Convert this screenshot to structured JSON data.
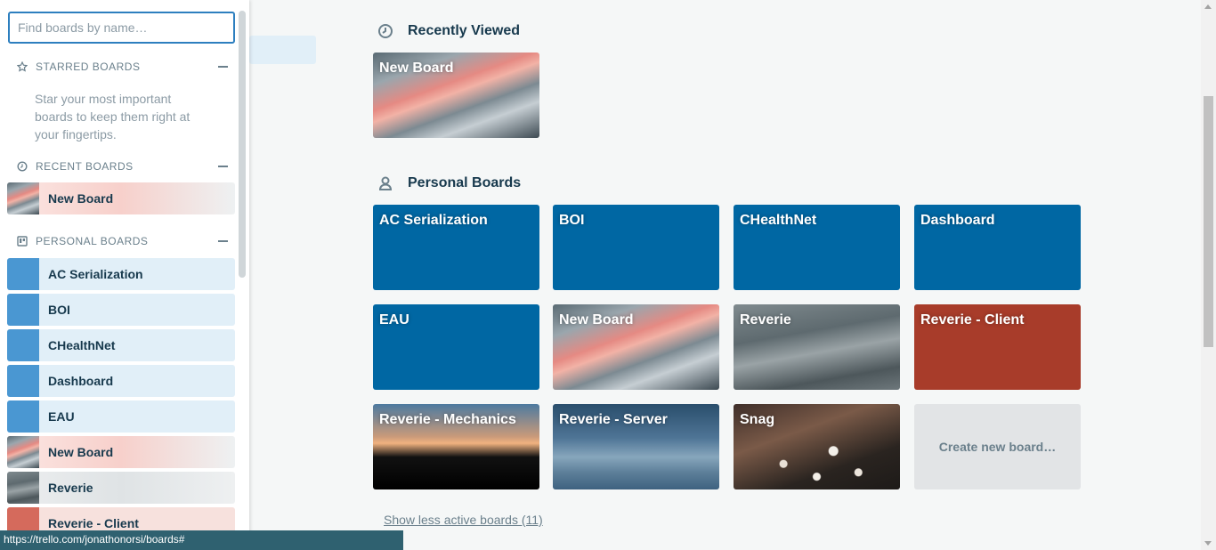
{
  "drawer": {
    "search_placeholder": "Find boards by name…",
    "starred": {
      "heading": "STARRED BOARDS",
      "icon": "star-icon",
      "hint": "Star your most important boards to keep them right at your fingertips."
    },
    "recent": {
      "heading": "RECENT BOARDS",
      "icon": "clock-icon",
      "items": [
        {
          "label": "New Board"
        }
      ]
    },
    "personal": {
      "heading": "PERSONAL BOARDS",
      "icon": "board-icon",
      "items": [
        {
          "label": "AC Serialization"
        },
        {
          "label": "BOI"
        },
        {
          "label": "CHealthNet"
        },
        {
          "label": "Dashboard"
        },
        {
          "label": "EAU"
        },
        {
          "label": "New Board"
        },
        {
          "label": "Reverie"
        },
        {
          "label": "Reverie - Client"
        }
      ]
    }
  },
  "main": {
    "recently_viewed": {
      "heading": "Recently Viewed",
      "icon": "clock-icon",
      "boards": [
        {
          "title": "New Board"
        }
      ]
    },
    "personal": {
      "heading": "Personal Boards",
      "icon": "person-icon",
      "boards": [
        {
          "title": "AC Serialization",
          "color": "#0067a3"
        },
        {
          "title": "BOI",
          "color": "#0067a3"
        },
        {
          "title": "CHealthNet",
          "color": "#0067a3"
        },
        {
          "title": "Dashboard",
          "color": "#0067a3"
        },
        {
          "title": "EAU",
          "color": "#0067a3"
        },
        {
          "title": "New Board"
        },
        {
          "title": "Reverie"
        },
        {
          "title": "Reverie - Client",
          "color": "#a83c2a"
        },
        {
          "title": "Reverie - Mechanics"
        },
        {
          "title": "Reverie - Server"
        },
        {
          "title": "Snag"
        }
      ],
      "create_label": "Create new board…"
    },
    "show_less": "Show less active boards (11)"
  },
  "status_url": "https://trello.com/jonathonorsi/boards#"
}
